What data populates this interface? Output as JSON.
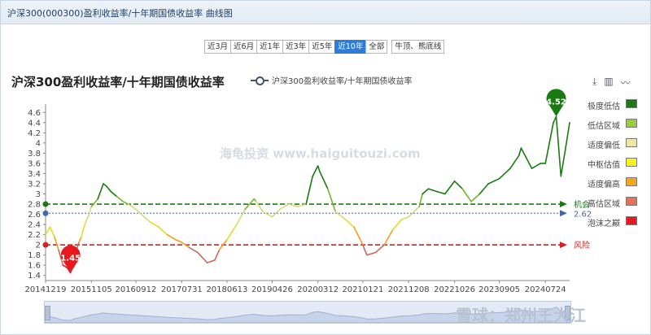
{
  "window": {
    "title": "沪深300(000300)盈利收益率/十年期国债收益率 曲线图"
  },
  "range_buttons": [
    {
      "label": "近3月",
      "active": false
    },
    {
      "label": "近6月",
      "active": false
    },
    {
      "label": "近1年",
      "active": false
    },
    {
      "label": "近3年",
      "active": false
    },
    {
      "label": "近5年",
      "active": false
    },
    {
      "label": "近10年",
      "active": true
    },
    {
      "label": "全部",
      "active": false
    }
  ],
  "extra_button": "牛顶、熊底线",
  "toolbar_icons": [
    "download-icon",
    "bar-chart-icon",
    "line-chart-icon"
  ],
  "watermark": "海龟投资 www.haiguitouzi.com",
  "brand_watermark": "雪球：郑州王大江",
  "zones": [
    {
      "label": "极度低估",
      "color": "#1a7a12"
    },
    {
      "label": "低估区域",
      "color": "#9ccb3c"
    },
    {
      "label": "适度偏低",
      "color": "#ece99a"
    },
    {
      "label": "中枢估值",
      "color": "#f6f21a"
    },
    {
      "label": "适度偏高",
      "color": "#f2a81d"
    },
    {
      "label": "高估区域",
      "color": "#e8705a"
    },
    {
      "label": "泡沫之巅",
      "color": "#e8191c"
    }
  ],
  "chart_data": {
    "type": "line",
    "title": "沪深300盈利收益率/十年期国债收益率",
    "series": [
      {
        "name": "沪深300盈利收益率/十年期国债收益率",
        "x": [
          "2014-12-19",
          "2015-01-20",
          "2015-02-20",
          "2015-03-20",
          "2015-04-20",
          "2015-05-20",
          "2015-06-12",
          "2015-07-08",
          "2015-08-10",
          "2015-08-26",
          "2015-09-20",
          "2015-10-20",
          "2015-11-05",
          "2015-12-20",
          "2016-01-28",
          "2016-02-20",
          "2016-03-20",
          "2016-05-01",
          "2016-06-15",
          "2016-07-20",
          "2016-09-12",
          "2016-10-20",
          "2016-12-20",
          "2017-02-20",
          "2017-04-20",
          "2017-06-20",
          "2017-07-31",
          "2017-09-20",
          "2017-11-20",
          "2018-01-25",
          "2018-03-20",
          "2018-04-20",
          "2018-06-13",
          "2018-08-20",
          "2018-10-18",
          "2018-12-20",
          "2019-01-04",
          "2019-02-20",
          "2019-04-26",
          "2019-06-20",
          "2019-08-20",
          "2019-10-20",
          "2019-12-20",
          "2020-02-04",
          "2020-03-12",
          "2020-03-23",
          "2020-05-20",
          "2020-07-13",
          "2020-09-20",
          "2020-11-20",
          "2021-01-21",
          "2021-02-18",
          "2021-04-20",
          "2021-06-20",
          "2021-08-20",
          "2021-10-20",
          "2021-12-08",
          "2022-02-20",
          "2022-03-15",
          "2022-04-26",
          "2022-06-20",
          "2022-08-20",
          "2022-10-26",
          "2022-12-20",
          "2023-02-20",
          "2023-04-20",
          "2023-06-20",
          "2023-09-05",
          "2023-11-20",
          "2024-01-20",
          "2024-02-05",
          "2024-04-20",
          "2024-06-20",
          "2024-07-24",
          "2024-09-18",
          "2024-10-08",
          "2024-11-10",
          "2024-12-10",
          "2025-01-10"
        ],
        "y": [
          2.2,
          2.35,
          2.15,
          1.9,
          1.6,
          1.55,
          1.45,
          1.75,
          2.05,
          2.15,
          2.4,
          2.6,
          2.75,
          2.9,
          3.2,
          3.15,
          3.05,
          2.95,
          2.85,
          2.8,
          2.7,
          2.6,
          2.45,
          2.35,
          2.2,
          2.1,
          2.05,
          1.95,
          1.85,
          1.65,
          1.7,
          1.9,
          2.1,
          2.4,
          2.7,
          2.9,
          2.85,
          2.65,
          2.55,
          2.7,
          2.8,
          2.75,
          2.8,
          3.35,
          3.55,
          3.45,
          3.1,
          2.65,
          2.5,
          2.35,
          2.0,
          1.8,
          1.85,
          2.0,
          2.3,
          2.5,
          2.55,
          2.75,
          3.0,
          3.1,
          3.05,
          3.0,
          3.25,
          3.1,
          2.85,
          3.0,
          3.2,
          3.3,
          3.5,
          3.75,
          3.9,
          3.5,
          3.6,
          3.6,
          4.4,
          4.52,
          3.35,
          3.85,
          4.4
        ]
      }
    ],
    "xlabel": "",
    "ylabel": "",
    "x_ticks": [
      "20141219",
      "20151105",
      "20160912",
      "20170731",
      "20180613",
      "20190426",
      "20200312",
      "20210121",
      "20211208",
      "20221026",
      "20230905",
      "20240724"
    ],
    "y_ticks": [
      1.4,
      1.6,
      1.8,
      2,
      2.2,
      2.4,
      2.6,
      2.8,
      3,
      3.2,
      3.4,
      3.6,
      3.8,
      4,
      4.2,
      4.4,
      4.6
    ],
    "ylim": [
      1.3,
      4.7
    ],
    "reference_lines": [
      {
        "value": 2.8,
        "label": "机会",
        "color": "#1a7a12"
      },
      {
        "value": 2.62,
        "label": "2.62",
        "color": "#4466aa"
      },
      {
        "value": 2.0,
        "label": "风险",
        "color": "#d42020"
      }
    ],
    "markers": [
      {
        "label": "1.45",
        "x": "2015-06-12",
        "y": 1.45,
        "color": "#e8191c"
      },
      {
        "label": "4.52",
        "x": "2024-10-08",
        "y": 4.52,
        "color": "#1a7a12"
      }
    ],
    "legend": "top-center",
    "grid": false
  }
}
